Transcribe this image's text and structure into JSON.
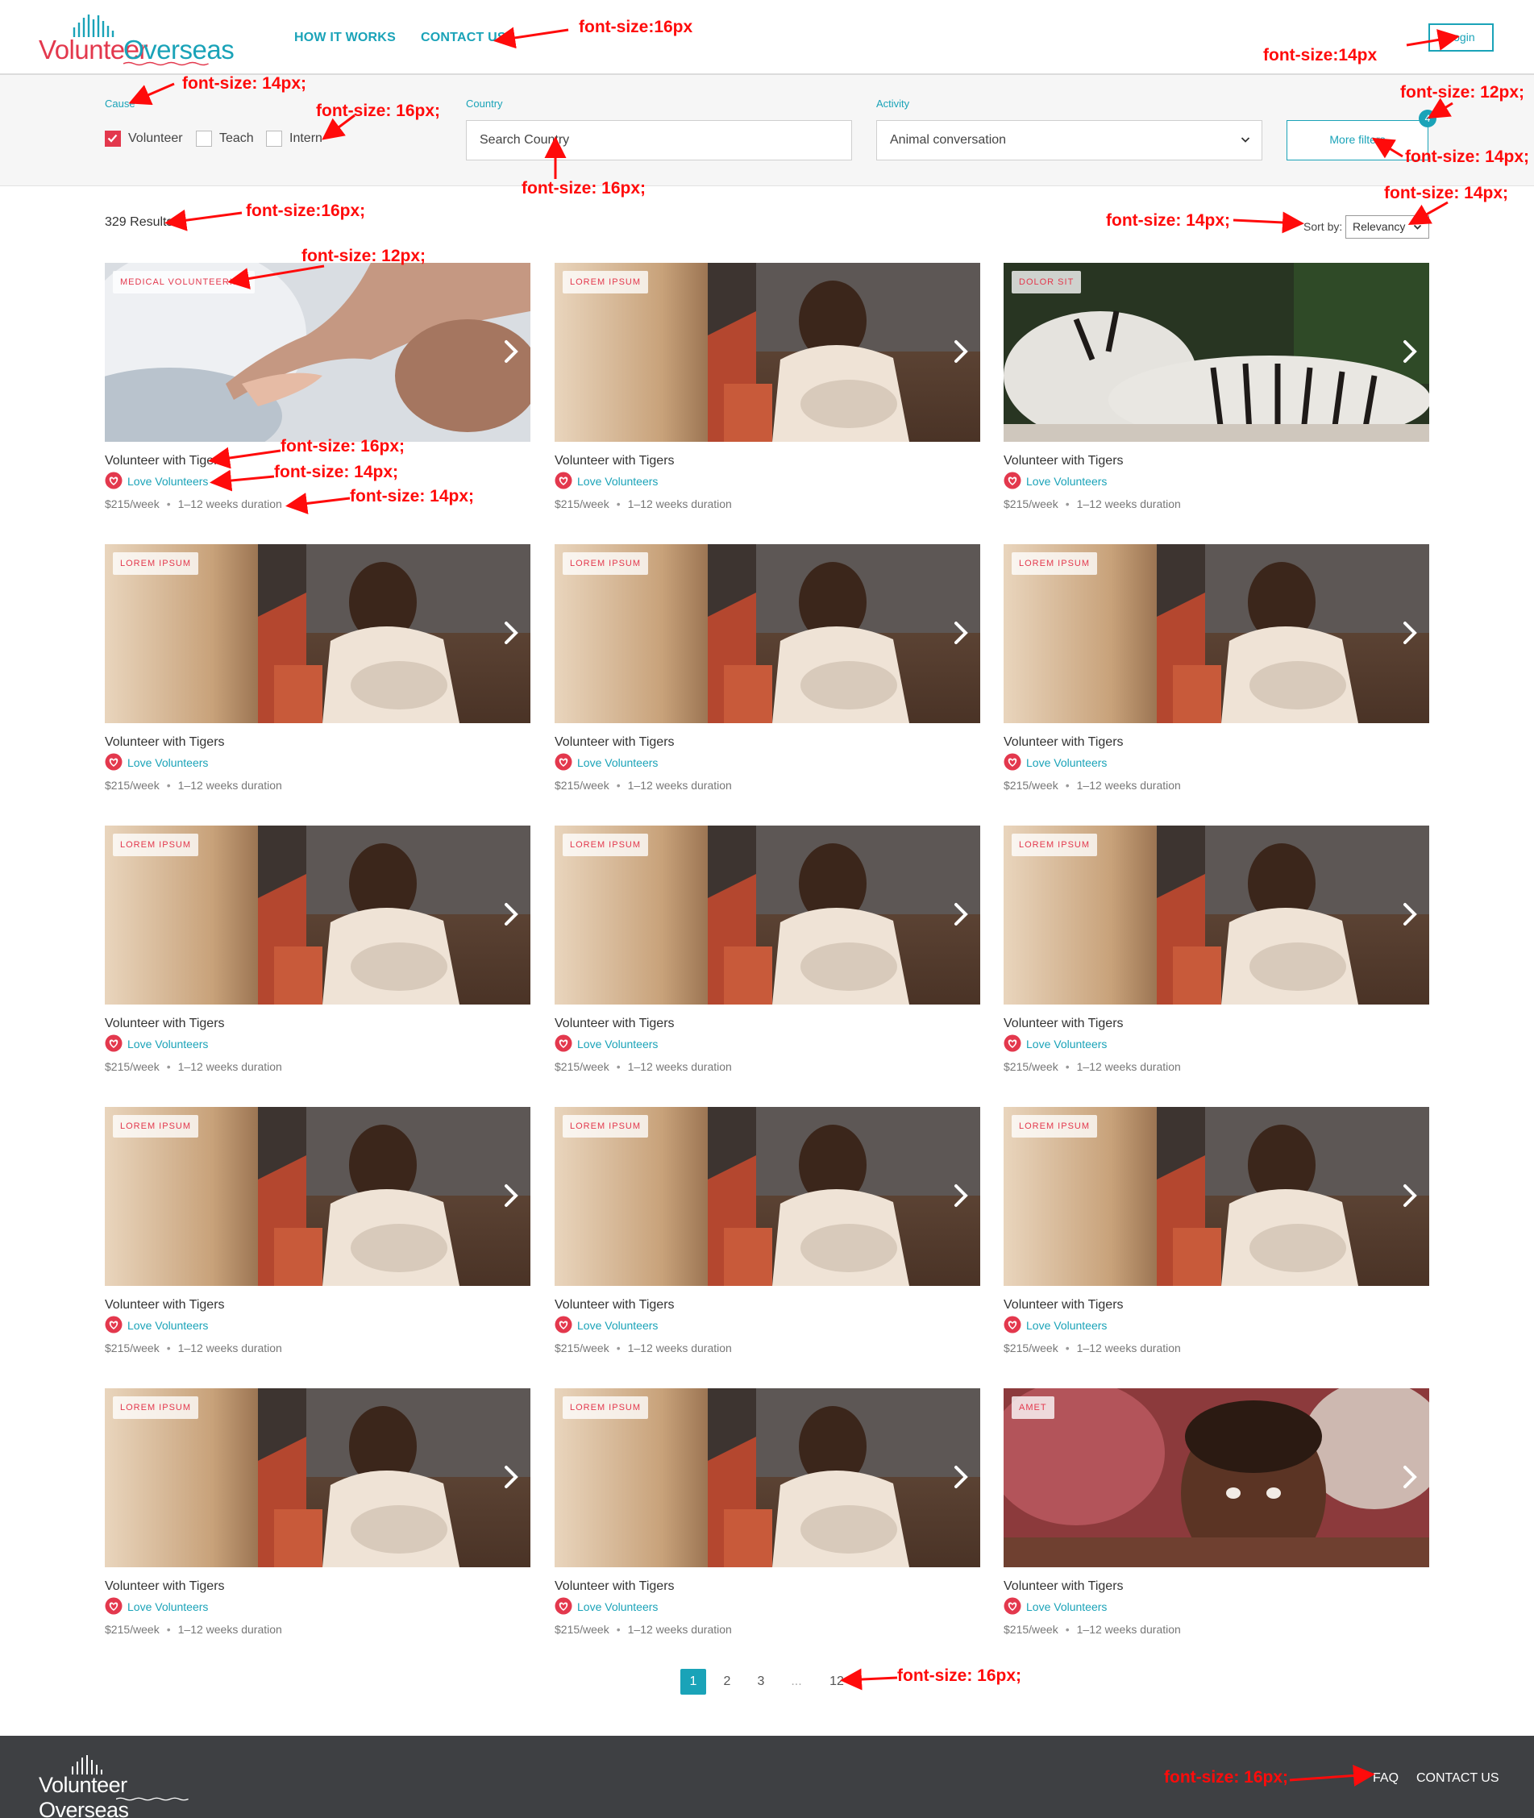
{
  "header": {
    "logo_volunteer": "Volunteer",
    "logo_overseas": "Overseas",
    "nav": [
      "HOW IT WORKS",
      "CONTACT US"
    ],
    "login_label": "Login"
  },
  "filters": {
    "cause_label": "Cause",
    "checkboxes": [
      {
        "label": "Volunteer",
        "checked": true
      },
      {
        "label": "Teach",
        "checked": false
      },
      {
        "label": "Intern",
        "checked": false
      }
    ],
    "country_label": "Country",
    "country_placeholder": "Search Country",
    "activity_label": "Activity",
    "activity_value": "Animal conversation",
    "more_filters_label": "More filters",
    "more_filters_count": "4"
  },
  "results": {
    "count_text": "329 Results",
    "sort_label": "Sort by:",
    "sort_value": "Relevancy"
  },
  "cards": [
    {
      "tag": "MEDICAL VOLUNTEERING",
      "image": "hands",
      "title": "Volunteer with Tigers",
      "org": "Love Volunteers",
      "price": "$215/week",
      "duration": "1–12 weeks duration"
    },
    {
      "tag": "LOREM IPSUM",
      "image": "child",
      "title": "Volunteer with Tigers",
      "org": "Love Volunteers",
      "price": "$215/week",
      "duration": "1–12 weeks duration"
    },
    {
      "tag": "DOLOR SIT",
      "image": "tiger",
      "title": "Volunteer with Tigers",
      "org": "Love Volunteers",
      "price": "$215/week",
      "duration": "1–12 weeks duration"
    },
    {
      "tag": "LOREM IPSUM",
      "image": "child",
      "title": "Volunteer with Tigers",
      "org": "Love Volunteers",
      "price": "$215/week",
      "duration": "1–12 weeks duration"
    },
    {
      "tag": "LOREM IPSUM",
      "image": "child",
      "title": "Volunteer with Tigers",
      "org": "Love Volunteers",
      "price": "$215/week",
      "duration": "1–12 weeks duration"
    },
    {
      "tag": "LOREM IPSUM",
      "image": "child",
      "title": "Volunteer with Tigers",
      "org": "Love Volunteers",
      "price": "$215/week",
      "duration": "1–12 weeks duration"
    },
    {
      "tag": "LOREM IPSUM",
      "image": "child",
      "title": "Volunteer with Tigers",
      "org": "Love Volunteers",
      "price": "$215/week",
      "duration": "1–12 weeks duration"
    },
    {
      "tag": "LOREM IPSUM",
      "image": "child",
      "title": "Volunteer with Tigers",
      "org": "Love Volunteers",
      "price": "$215/week",
      "duration": "1–12 weeks duration"
    },
    {
      "tag": "LOREM IPSUM",
      "image": "child",
      "title": "Volunteer with Tigers",
      "org": "Love Volunteers",
      "price": "$215/week",
      "duration": "1–12 weeks duration"
    },
    {
      "tag": "LOREM IPSUM",
      "image": "child",
      "title": "Volunteer with Tigers",
      "org": "Love Volunteers",
      "price": "$215/week",
      "duration": "1–12 weeks duration"
    },
    {
      "tag": "LOREM IPSUM",
      "image": "child",
      "title": "Volunteer with Tigers",
      "org": "Love Volunteers",
      "price": "$215/week",
      "duration": "1–12 weeks duration"
    },
    {
      "tag": "LOREM IPSUM",
      "image": "child",
      "title": "Volunteer with Tigers",
      "org": "Love Volunteers",
      "price": "$215/week",
      "duration": "1–12 weeks duration"
    },
    {
      "tag": "LOREM IPSUM",
      "image": "child",
      "title": "Volunteer with Tigers",
      "org": "Love Volunteers",
      "price": "$215/week",
      "duration": "1–12 weeks duration"
    },
    {
      "tag": "LOREM IPSUM",
      "image": "child",
      "title": "Volunteer with Tigers",
      "org": "Love Volunteers",
      "price": "$215/week",
      "duration": "1–12 weeks duration"
    },
    {
      "tag": "AMET",
      "image": "boy",
      "title": "Volunteer with Tigers",
      "org": "Love Volunteers",
      "price": "$215/week",
      "duration": "1–12 weeks duration"
    }
  ],
  "pagination": [
    "1",
    "2",
    "3",
    "...",
    "12"
  ],
  "pagination_active": "1",
  "footer": {
    "logo_text": "Volunteer Overseas",
    "nav": [
      "FAQ",
      "CONTACT US"
    ]
  },
  "annotations": {
    "nav": "font-size:16px",
    "login": "font-size:14px",
    "cause": "font-size: 14px;",
    "checkbox": "font-size: 16px;",
    "badge": "font-size: 12px;",
    "country": "font-size: 16px;",
    "more_filters": "font-size: 14px;",
    "results": "font-size:16px;",
    "sort_label": "font-size: 14px;",
    "sort_value": "font-size: 14px;",
    "tag": "font-size: 12px;",
    "title": "font-size: 16px;",
    "org": "font-size: 14px;",
    "meta": "font-size: 14px;",
    "pagination": "font-size: 16px;",
    "footer": "font-size: 16px;"
  },
  "colors": {
    "brand_teal": "#1aa3b8",
    "brand_red": "#e3384d",
    "footer_bg": "#3e4043",
    "annotation_red": "#ff0b0b"
  }
}
